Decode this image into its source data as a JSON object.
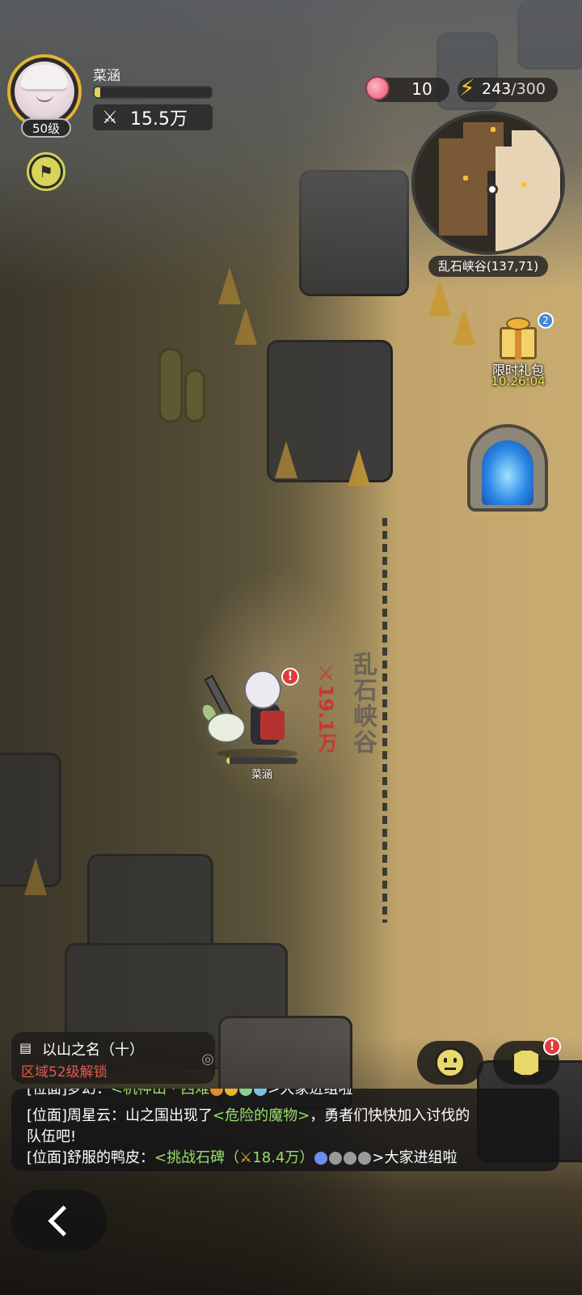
{
  "player": {
    "name": "菜涵",
    "level_label": "50级",
    "exp_fraction": 0.05,
    "power_value": "15.5万"
  },
  "resources": {
    "peach_count": "10",
    "energy_current": "243",
    "energy_max": "/300"
  },
  "minimap": {
    "location_label": "乱石峡谷(137,71)"
  },
  "gift": {
    "label": "限时礼包",
    "timer": "10:26:04",
    "badge_count": "2"
  },
  "character": {
    "name": "菜涵",
    "hp_fraction": 0.05,
    "alert": "!"
  },
  "zone": {
    "name": "乱石峡谷",
    "power_req": "19.1万"
  },
  "quest": {
    "title": "以山之名（十）",
    "requirement": "区域52级解锁"
  },
  "action_buttons": {
    "box_alert": "!"
  },
  "chat": {
    "line0_prefix": "[位面]梦幻：",
    "line0_link": "<机神山 · 西难",
    "line0_suffix": ">大家进组啦",
    "line1_prefix": "[位面]周星云：山之国出现了",
    "line1_link": "<危险的魔物>",
    "line1_suffix": "，勇者们快快加入讨伐的",
    "line2": "队伍吧!",
    "line3_prefix": "[位面]舒服的鸭皮：",
    "line3_link": "<挑战石碑（",
    "line3_power": "18.4万",
    "line3_link_end": "）",
    "line3_suffix": ">大家进组啦"
  },
  "colors": {
    "accent_yellow": "#e9d96a",
    "alert_red": "#e23b3b",
    "chat_link_green": "#9adf6a",
    "requirement_red": "#e25a4f"
  },
  "icons": {
    "flag": "flag-icon",
    "peach": "peach-icon",
    "energy": "lightning-bolt-icon",
    "power": "crossed-swords-icon",
    "quest": "clipboard-icon",
    "target": "target-icon",
    "emoji": "emoji-face-icon",
    "box": "cube-box-icon",
    "back": "chevron-left-icon"
  }
}
